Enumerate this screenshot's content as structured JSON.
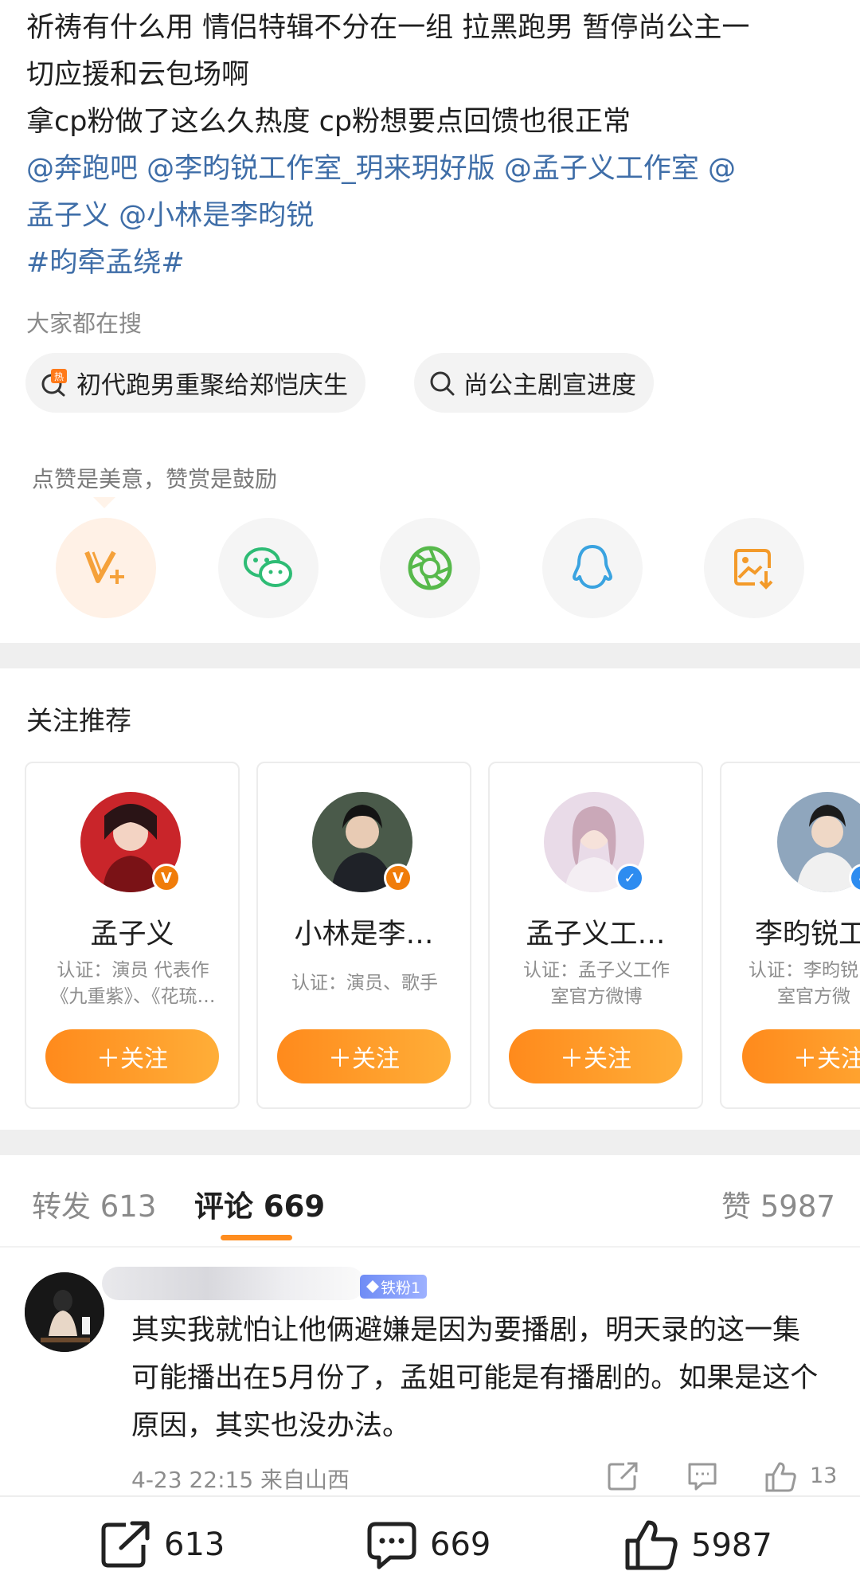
{
  "post": {
    "line1": "祈祷有什么用 情侣特辑不分在一组 拉黑跑男 暂停尚公主一",
    "line2": "切应援和云包场啊",
    "line3": "拿cp粉做了这么久热度 cp粉想要点回馈也很正常",
    "mention1": "@奔跑吧",
    "mention2": "@李昀锐工作室_玥来玥好版",
    "mention3": "@孟子义工作室",
    "mention4_a": "@",
    "mention4_b": "孟子义",
    "mention5": "@小林是李昀锐",
    "hashtag": "#昀牵孟绕#"
  },
  "search": {
    "label": "大家都在搜",
    "chips": [
      {
        "text": "初代跑男重聚给郑恺庆生",
        "icon": "hot-search-icon"
      },
      {
        "text": "尚公主剧宣进度",
        "icon": "search-icon"
      }
    ]
  },
  "reward": {
    "label": "点赞是美意，赞赏是鼓励",
    "share_icons": [
      "reward-v-plus-icon",
      "wechat-icon",
      "moments-icon",
      "qq-icon",
      "save-image-icon"
    ]
  },
  "recommend": {
    "title": "关注推荐",
    "follow_label": "＋关注",
    "cards": [
      {
        "name": "孟子义",
        "desc1": "认证：演员 代表作",
        "desc2": "《九重紫》、《花琉…",
        "badge": "V",
        "badge_color": "#f07c0a"
      },
      {
        "name": "小林是李…",
        "desc1": "认证：演员、歌手",
        "desc2": "",
        "badge": "V",
        "badge_color": "#f07c0a"
      },
      {
        "name": "孟子义工…",
        "desc1": "认证：孟子义工作",
        "desc2": "室官方微博",
        "badge": "✓",
        "badge_color": "#2d8cf0"
      },
      {
        "name": "李昀锐工",
        "desc1": "认证：李昀锐",
        "desc2": "室官方微",
        "badge": "✓",
        "badge_color": "#2d8cf0"
      }
    ]
  },
  "tabs": {
    "repost": "转发 613",
    "comments": "评论 669",
    "likes": "赞 5987"
  },
  "comment": {
    "fan_badge": "铁粉1",
    "text": "其实我就怕让他俩避嫌是因为要播剧，明天录的这一集可能播出在5月份了，孟姐可能是有播剧的。如果是这个原因，其实也没办法。",
    "time": "4-23 22:15",
    "location": "来自山西",
    "like_count": "13"
  },
  "bottom": {
    "repost": "613",
    "comment": "669",
    "like": "5987"
  },
  "colors": {
    "link": "#3f6ea8",
    "accent": "#ff8d1f",
    "follow_gradient_start": "#ff8a1c",
    "follow_gradient_end": "#ffae38"
  }
}
